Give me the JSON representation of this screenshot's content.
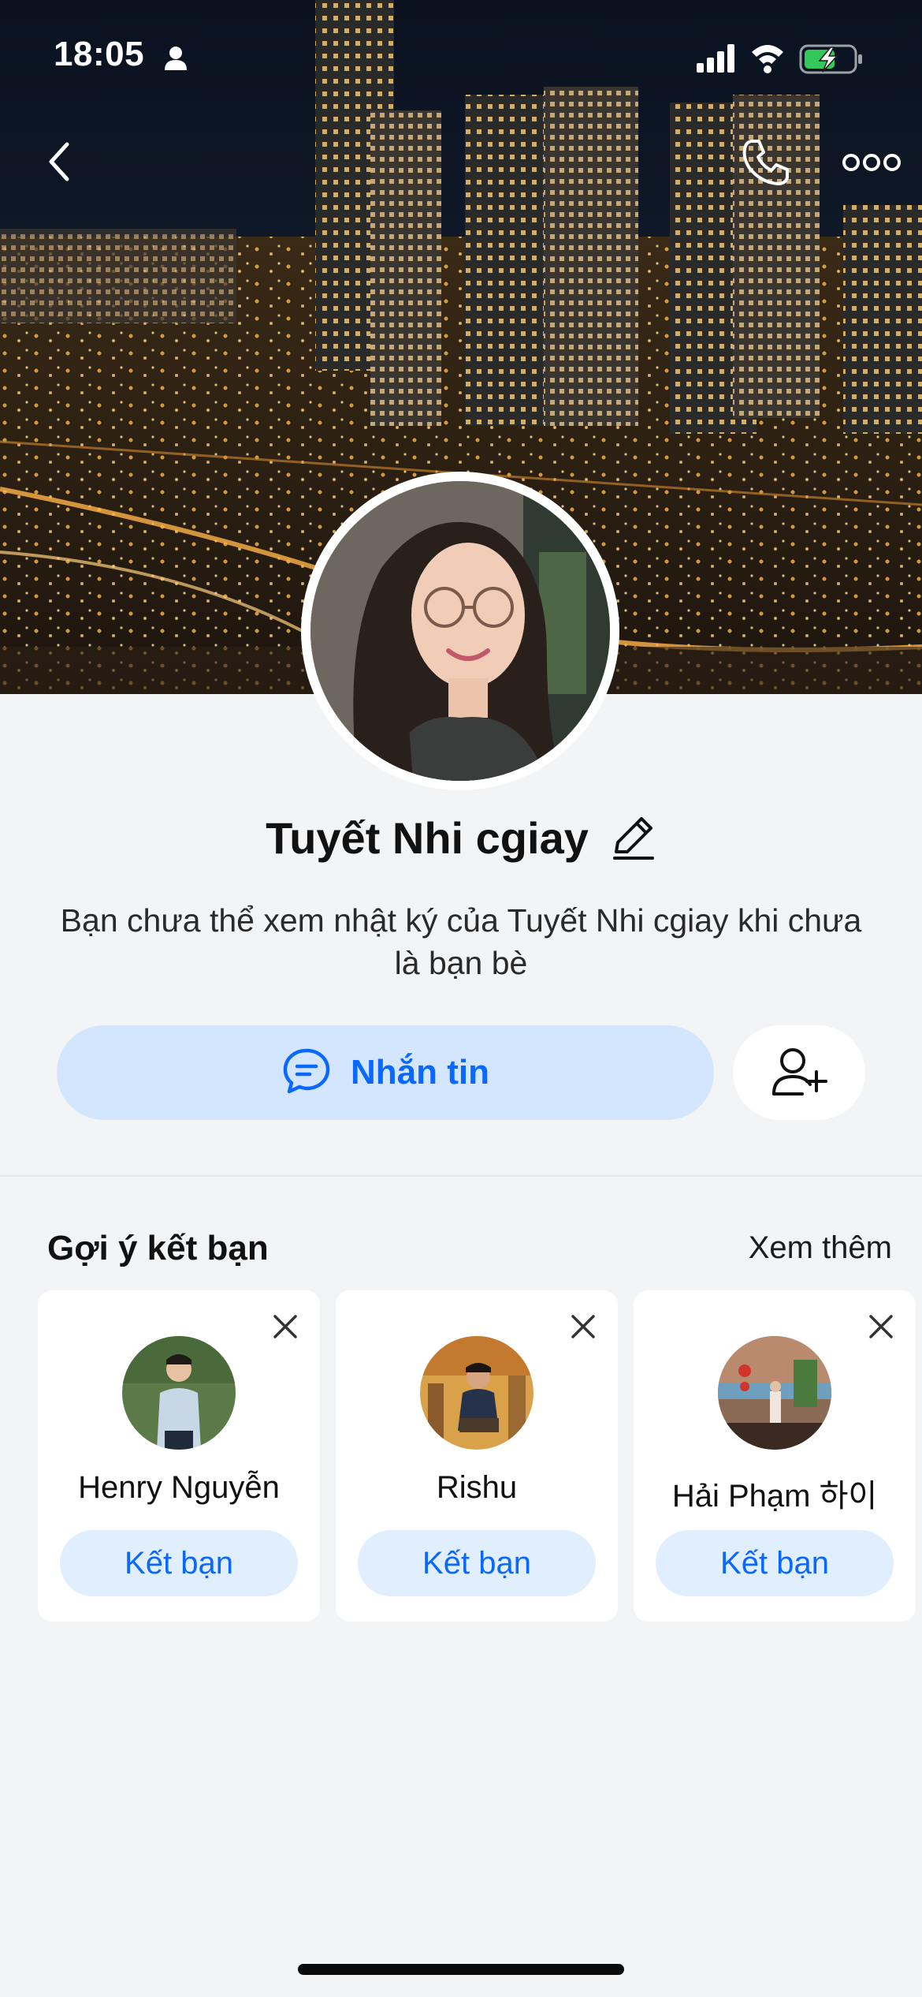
{
  "status_bar": {
    "time": "18:05",
    "icons": [
      "person-icon",
      "signal-icon",
      "wifi-icon",
      "battery-charging-icon"
    ]
  },
  "nav": {
    "back_icon": "chevron-left-icon",
    "call_icon": "phone-icon",
    "more_icon": "more-dots-icon"
  },
  "profile": {
    "name": "Tuyết Nhi cgiay",
    "privacy_note": "Bạn chưa thể xem nhật ký của Tuyết Nhi cgiay khi chưa là bạn bè"
  },
  "actions": {
    "message_label": "Nhắn tin",
    "message_icon": "chat-bubble-icon",
    "add_friend_icon": "add-user-icon"
  },
  "suggestions": {
    "title": "Gợi ý kết bạn",
    "see_more": "Xem thêm",
    "cards": [
      {
        "name": "Henry Nguyễn",
        "button": "Kết bạn"
      },
      {
        "name": "Rishu",
        "button": "Kết bạn"
      },
      {
        "name": "Hải Phạm 하이",
        "button": "Kết bạn"
      }
    ]
  },
  "colors": {
    "accent": "#0a68ff",
    "message_button_bg": "#d4e6fd",
    "card_button_bg": "#e1eefd",
    "page_bg": "#f3f4f6"
  }
}
